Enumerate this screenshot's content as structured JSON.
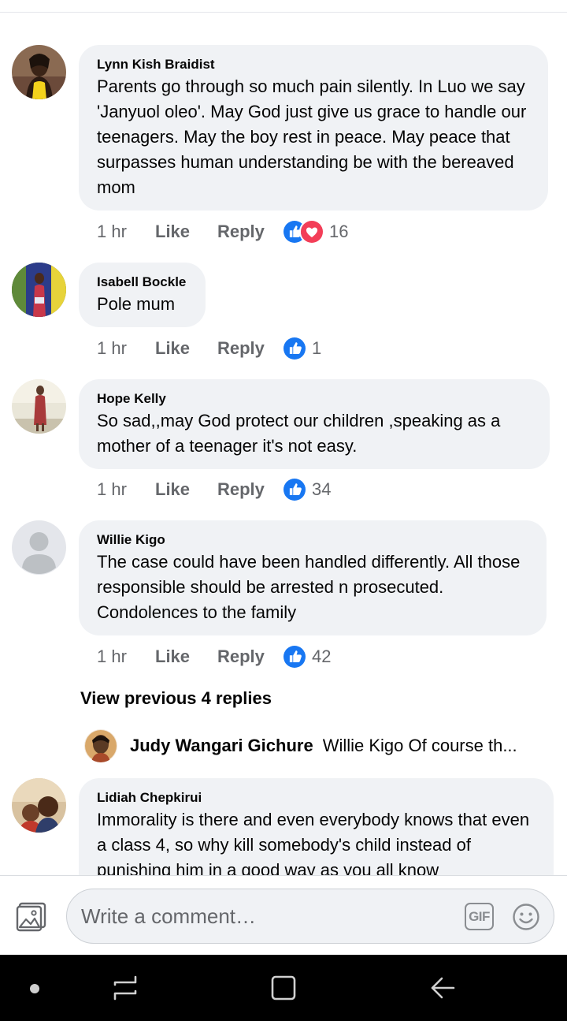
{
  "comments": [
    {
      "author": "Lynn Kish Braidist",
      "text": "Parents go through so much pain silently. In Luo we say 'Janyuol oleo'. May God just give us grace to handle our teenagers. May the boy rest in peace. May peace that surpasses human understanding be with the bereaved mom",
      "time": "1 hr",
      "like_label": "Like",
      "reply_label": "Reply",
      "reactions": [
        "like-icon",
        "love-icon"
      ],
      "reaction_count": "16"
    },
    {
      "author": "Isabell Bockle",
      "text": "Pole mum",
      "time": "1 hr",
      "like_label": "Like",
      "reply_label": "Reply",
      "reactions": [
        "like-icon"
      ],
      "reaction_count": "1"
    },
    {
      "author": "Hope Kelly",
      "text": "So sad,,may God protect our children ,speaking as a mother of a teenager it's not easy.",
      "time": "1 hr",
      "like_label": "Like",
      "reply_label": "Reply",
      "reactions": [
        "like-icon"
      ],
      "reaction_count": "34"
    },
    {
      "author": "Willie Kigo",
      "text": "The case could have been handled differently. All those responsible should be arrested n prosecuted. Condolences to the family",
      "time": "1 hr",
      "like_label": "Like",
      "reply_label": "Reply",
      "reactions": [
        "like-icon"
      ],
      "reaction_count": "42"
    },
    {
      "author": "Lidiah Chepkirui",
      "text": "Immorality is there and even everybody knows that even a class 4, so why kill somebody's child  instead of punishing him in a good way as you all know"
    }
  ],
  "view_previous": "View previous 4 replies",
  "reply_preview": {
    "author": "Judy Wangari Gichure",
    "text": "Willie Kigo Of course th..."
  },
  "composer": {
    "placeholder": "Write a comment…",
    "gif_label": "GIF",
    "photo_icon": "photo-icon",
    "emoji_icon": "emoji-icon"
  },
  "colors": {
    "bubble": "#f0f2f5",
    "like_blue": "#1877f2",
    "love_red": "#f33e58",
    "meta_gray": "#65676b"
  }
}
